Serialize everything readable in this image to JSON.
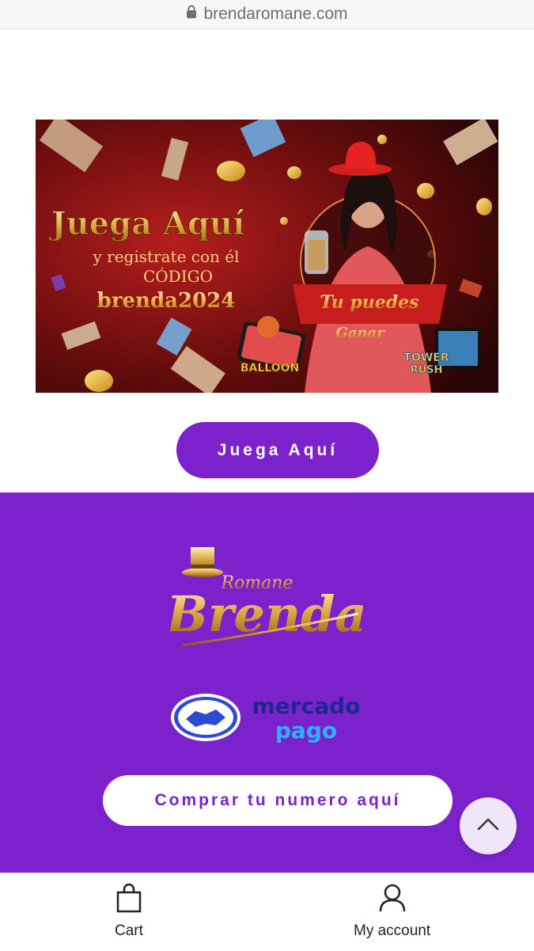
{
  "browser": {
    "url": "brendaromane.com"
  },
  "banner": {
    "headline": "Juega Aquí",
    "line2": "y registrate con él",
    "line3": "CÓDIGO",
    "code": "brenda2024",
    "ribbon_line1": "Tu puedes",
    "ribbon_line2": "Ganar",
    "game1": "BALLOON",
    "game2_line1": "TOWER",
    "game2_line2": "RUSH"
  },
  "play_button": {
    "label": "Juega Aquí"
  },
  "footer": {
    "logo_small": "Romane",
    "logo_big": "Brenda",
    "payment": {
      "line1": "mercado",
      "line2": "pago"
    },
    "buy_button": {
      "label": "Comprar tu numero aquí"
    }
  },
  "bottom_nav": {
    "items": [
      {
        "label": "Cart",
        "icon": "shopping-bag-icon"
      },
      {
        "label": "My account",
        "icon": "user-icon"
      }
    ]
  },
  "colors": {
    "brand_purple": "#7b22cc",
    "gold": "#e8b04a",
    "banner_dark": "#3a0808"
  }
}
